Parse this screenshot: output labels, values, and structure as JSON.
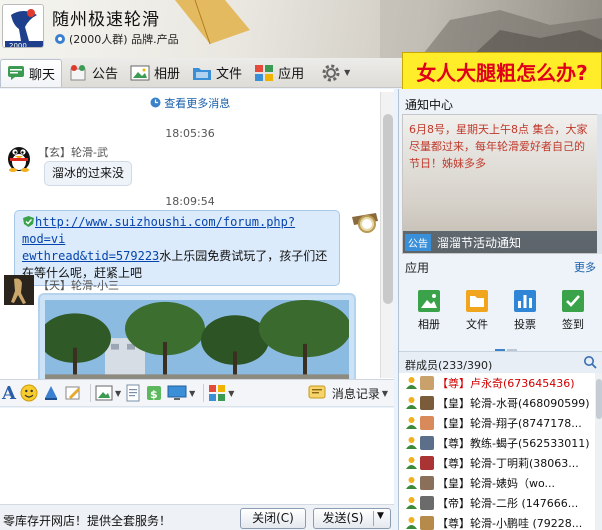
{
  "header": {
    "group_name": "随州极速轮滑",
    "group_desc": "(2000人群) 品牌.产品"
  },
  "tabs": [
    {
      "label": "聊天",
      "icon": "chat-icon",
      "active": true
    },
    {
      "label": "公告",
      "icon": "announcement-icon"
    },
    {
      "label": "相册",
      "icon": "album-icon"
    },
    {
      "label": "文件",
      "icon": "folder-icon"
    },
    {
      "label": "应用",
      "icon": "apps-icon"
    }
  ],
  "ad_banner": "女人大腿粗怎么办?",
  "chat": {
    "view_more": "查看更多消息",
    "messages": [
      {
        "time": "18:05:36",
        "sender": "【玄】轮滑-武",
        "text": "溜冰的过来没"
      },
      {
        "time": "18:09:54",
        "link": "http://www.suizhoushi.com/forum.php?mod=viewthread&tid=579223",
        "link_line1": "http://www.suizhoushi.com/forum.php?mod=vi",
        "link_line2": "ewthread&tid=579223",
        "text_after_link": "水上乐园免费试玩了，孩子们还",
        "text_line2": "在等什么呢，赶紧上吧"
      },
      {
        "sender": "【天】轮滑-小三"
      }
    ]
  },
  "toolbar": {
    "history_label": "消息记录"
  },
  "footer": {
    "text": "零库存开网店！提供全套服务！",
    "close_label": "关闭(C)",
    "send_label": "发送(S)"
  },
  "right": {
    "notice_title": "通知中心",
    "notice_text": "6月8号，星期天上午8点 集合，大家尽量都过来，每年轮滑爱好者自己的节日！姊妹多多",
    "notice_tag": "公告",
    "notice_link": "溜溜节活动通知",
    "apps_title": "应用",
    "apps_more": "更多",
    "apps": [
      {
        "label": "相册",
        "icon": "album-app-icon",
        "color": "#3aa34a"
      },
      {
        "label": "文件",
        "icon": "file-app-icon",
        "color": "#f0a51d"
      },
      {
        "label": "投票",
        "icon": "vote-app-icon",
        "color": "#2f86d6"
      },
      {
        "label": "签到",
        "icon": "checkin-app-icon",
        "color": "#3aa34a"
      }
    ],
    "members_title": "群成员(233/390)",
    "members": [
      {
        "role": "【尊】",
        "name": "卢永奇(673645436)",
        "top": true
      },
      {
        "role": "【皇】",
        "name": "轮滑-水哥(468090599)"
      },
      {
        "role": "【皇】",
        "name": "轮滑-翔子(8747178..."
      },
      {
        "role": "【尊】",
        "name": "教练-蝎子(562533011)"
      },
      {
        "role": "【尊】",
        "name": "轮滑-丁明莉(38063..."
      },
      {
        "role": "【皇】",
        "name": "轮滑-婊妈（wo..."
      },
      {
        "role": "【帝】",
        "name": "轮滑-二彤 (147666..."
      },
      {
        "role": "【尊】",
        "name": "轮滑-小鹏哇 (79228..."
      }
    ]
  }
}
